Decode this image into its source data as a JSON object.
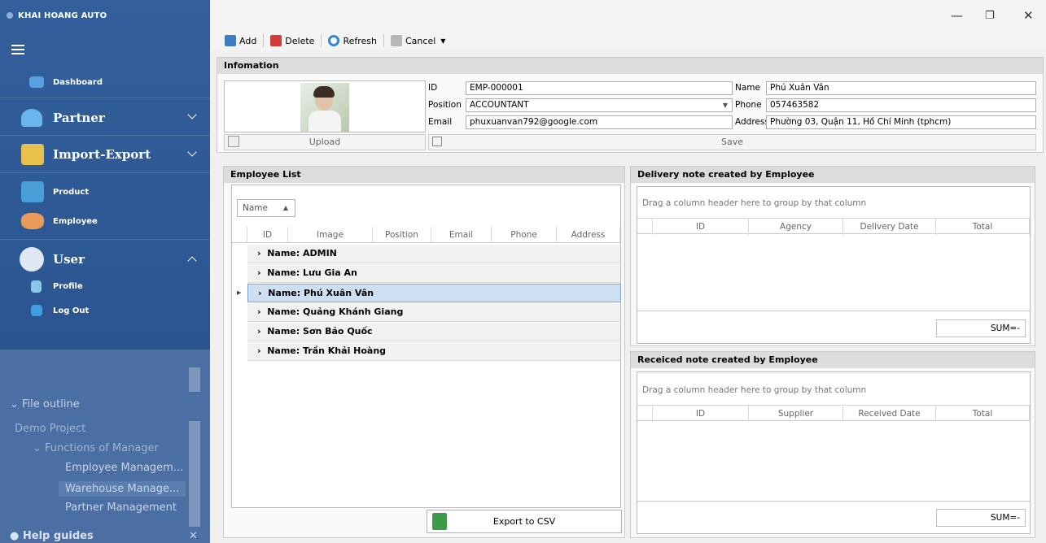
{
  "app": {
    "title": "KHAI HOANG AUTO"
  },
  "sidebar": {
    "items": [
      {
        "label": "Dashboard"
      },
      {
        "label": "Partner"
      },
      {
        "label": "Import-Export"
      },
      {
        "label": "Product"
      },
      {
        "label": "Employee"
      },
      {
        "label": "User"
      },
      {
        "label": "Profile"
      },
      {
        "label": "Log Out"
      }
    ],
    "faded": {
      "file_outline": "File outline",
      "project": "Demo Project",
      "functions": "Functions of Manager",
      "items": [
        "Employee Managem...",
        "Warehouse Manage...",
        "Partner Management"
      ],
      "help": "Help guides"
    }
  },
  "toolbar": {
    "add": "Add",
    "delete": "Delete",
    "refresh": "Refresh",
    "cancel": "Cancel"
  },
  "info": {
    "title": "Infomation",
    "upload": "Upload",
    "save": "Save",
    "id_label": "ID",
    "id_value": "EMP-000001",
    "position_label": "Position",
    "position_value": "ACCOUNTANT",
    "email_label": "Email",
    "email_value": "phuxuanvan792@google.com",
    "name_label": "Name",
    "name_value": "Phú Xuân Vân",
    "phone_label": "Phone",
    "phone_value": "057463582",
    "address_label": "Address",
    "address_value": "Phường 03, Quận 11, Hồ Chí Minh (tphcm)"
  },
  "employee_list": {
    "title": "Employee List",
    "group_chip": "Name",
    "columns": [
      "ID",
      "Image",
      "Position",
      "Email",
      "Phone",
      "Address"
    ],
    "groups": [
      "Name: ADMIN",
      "Name: Lưu Gia An",
      "Name: Phú Xuân Vân",
      "Name: Quảng Khánh Giang",
      "Name: Sơn Bảo Quốc",
      "Name: Trần Khải Hoàng"
    ],
    "export": "Export to CSV"
  },
  "delivery": {
    "title": "Delivery note created by Employee",
    "drag": "Drag a column header here to group by that column",
    "columns": [
      "ID",
      "Agency",
      "Delivery Date",
      "Total"
    ],
    "sum": "SUM=-"
  },
  "received": {
    "title": "Receiced note created by Employee",
    "drag": "Drag a column header here to group by that column",
    "columns": [
      "ID",
      "Supplier",
      "Received Date",
      "Total"
    ],
    "sum": "SUM=-"
  }
}
